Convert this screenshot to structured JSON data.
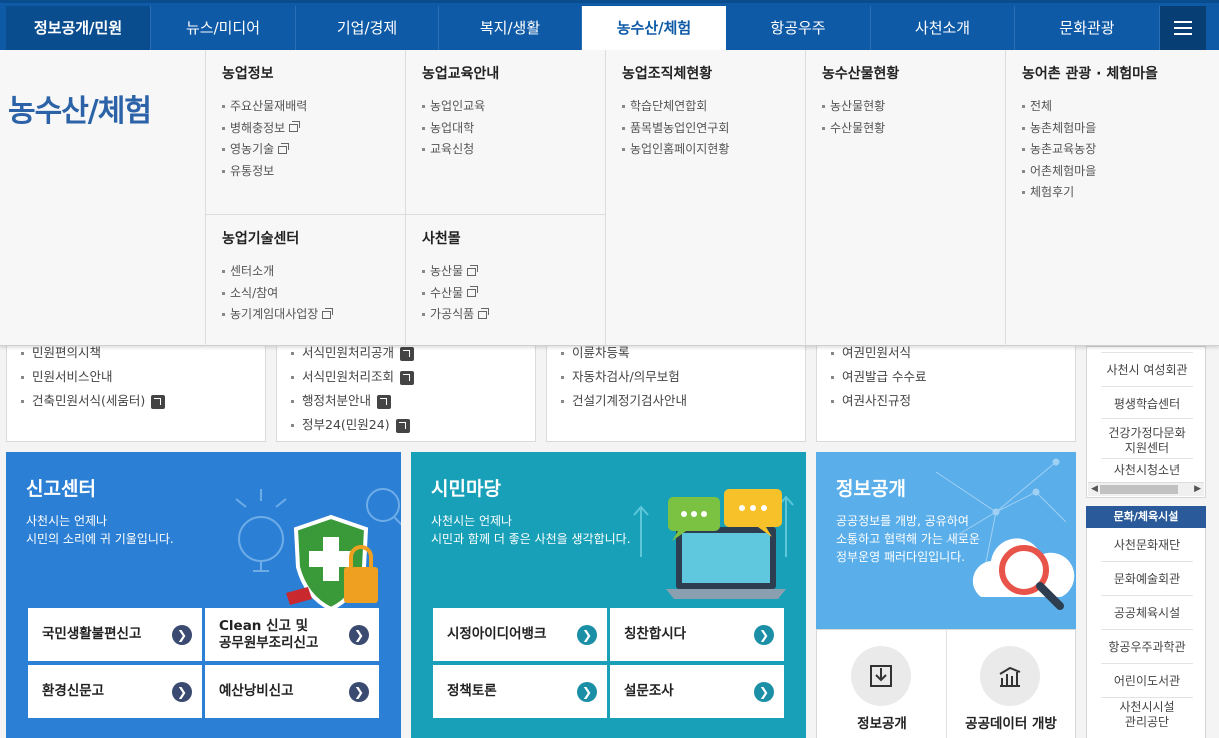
{
  "nav": {
    "items": [
      "정보공개/민원",
      "뉴스/미디어",
      "기업/경제",
      "복지/생활",
      "농수산/체험",
      "항공우주",
      "사천소개",
      "문화관광"
    ],
    "active_index": 4
  },
  "mega": {
    "title": "농수산/체험",
    "col1": {
      "heading": "농업정보",
      "items": [
        "주요산물재배력",
        "병해충정보",
        "영농기술",
        "유통정보"
      ]
    },
    "col2": {
      "heading": "농업교육안내",
      "items": [
        "농업인교육",
        "농업대학",
        "교육신청"
      ]
    },
    "col3": {
      "heading": "농업조직체현황",
      "items": [
        "학습단체연합회",
        "품목별농업인연구회",
        "농업인홈페이지현황"
      ]
    },
    "col4": {
      "heading": "농수산물현황",
      "items": [
        "농산물현황",
        "수산물현황"
      ]
    },
    "col5": {
      "heading": "농어촌 관광 · 체험마을",
      "items": [
        "전체",
        "농촌체험마을",
        "농촌교육농장",
        "어촌체험마을",
        "체험후기"
      ]
    },
    "col6": {
      "heading": "농업기술센터",
      "items": [
        "센터소개",
        "소식/참여",
        "농기계임대사업장"
      ]
    },
    "col7": {
      "heading": "사천몰",
      "items": [
        "농산물",
        "수산물",
        "가공식품"
      ]
    }
  },
  "info": {
    "box1": [
      "민원편의시책",
      "민원서비스안내",
      "건축민원서식(세움터)"
    ],
    "box2": [
      "서식민원처리공개",
      "서식민원처리조회",
      "행정처분안내",
      "정부24(민원24)"
    ],
    "box3": [
      "이륜차등록",
      "자동차검사/의무보험",
      "건설기계정기검사안내"
    ],
    "box4": [
      "여권민원서식",
      "여권발급 수수료",
      "여권사진규정"
    ]
  },
  "sidebar": {
    "top_items": [
      "사천시 여성회관",
      "평생학습센터",
      "건강가정다문화\n지원센터",
      "사천시청소년"
    ],
    "culture_heading": "문화/체육시설",
    "culture_items": [
      "사천문화재단",
      "문화예술회관",
      "공공체육시설",
      "항공우주과학관",
      "어린이도서관",
      "사천시시설\n관리공단"
    ]
  },
  "report": {
    "title": "신고센터",
    "desc_line1": "사천시는 언제나",
    "desc_line2": "시민의 소리에 귀 기울입니다.",
    "buttons": [
      "국민생활불편신고",
      "Clean 신고 및\n공무원부조리신고",
      "환경신문고",
      "예산낭비신고"
    ],
    "bg_color": "#2b7fd4"
  },
  "citizen": {
    "title": "시민마당",
    "desc_line1": "사천시는 언제나",
    "desc_line2": "시민과 함께 더 좋은 사천을 생각합니다.",
    "buttons": [
      "시정아이디어뱅크",
      "칭찬합시다",
      "정책토론",
      "설문조사"
    ],
    "bg_color": "#17a0b8"
  },
  "disclosure": {
    "title": "정보공개",
    "desc_line1": "공공정보를 개방, 공유하여",
    "desc_line2": "소통하고 협력해 가는 새로운",
    "desc_line3": "정부운영 패러다임입니다.",
    "links": [
      "정보공개",
      "공공데이터 개방"
    ],
    "bg_color": "#5aaeea"
  }
}
